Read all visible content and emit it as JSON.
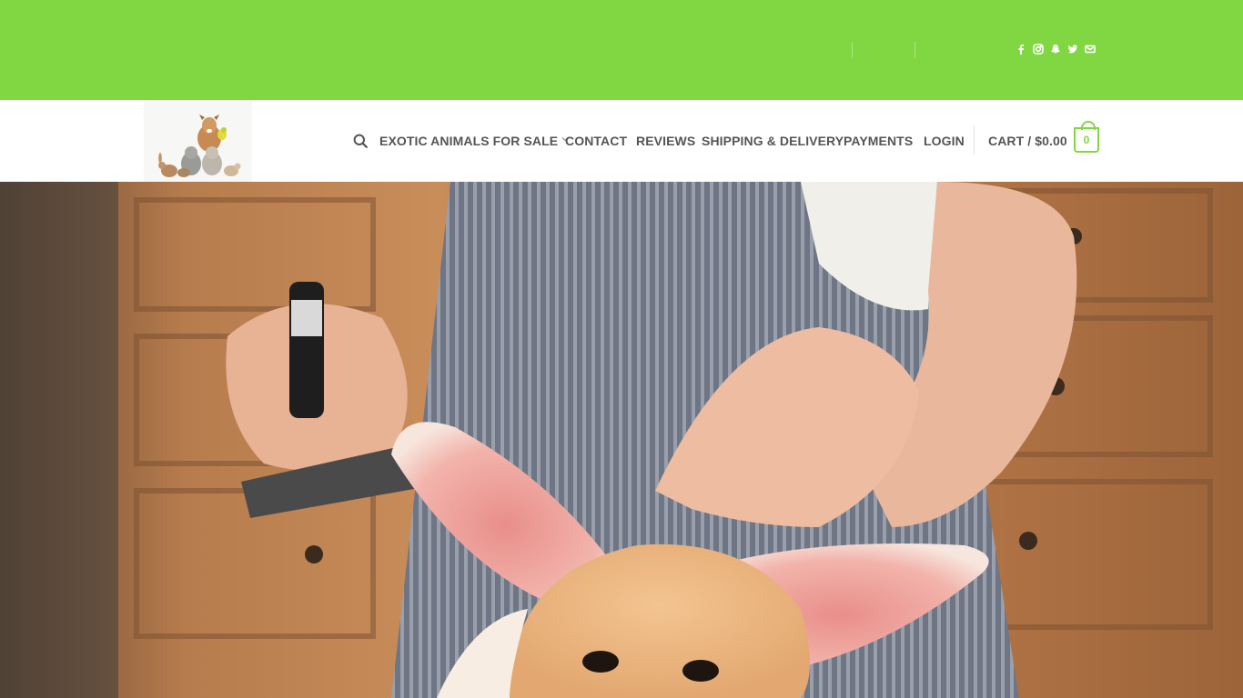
{
  "topbar": {
    "bg_color": "#81d742",
    "social_icons": [
      "facebook-icon",
      "instagram-icon",
      "snapchat-icon",
      "twitter-icon",
      "envelope-icon"
    ]
  },
  "header": {
    "logo_alt": "pets logo",
    "nav": {
      "exotic": "EXOTIC ANIMALS FOR SALE",
      "contact": "CONTACT",
      "reviews": "REVIEWS",
      "shipping": "SHIPPING & DELIVERY",
      "payments": "PAYMENTS",
      "login": "LOGIN"
    },
    "cart": {
      "label": "CART / $0.00",
      "count": "0"
    }
  },
  "hero": {
    "image_alt": "fennec fox being groomed"
  },
  "colors": {
    "accent": "#81d742",
    "nav_text": "#555555"
  }
}
